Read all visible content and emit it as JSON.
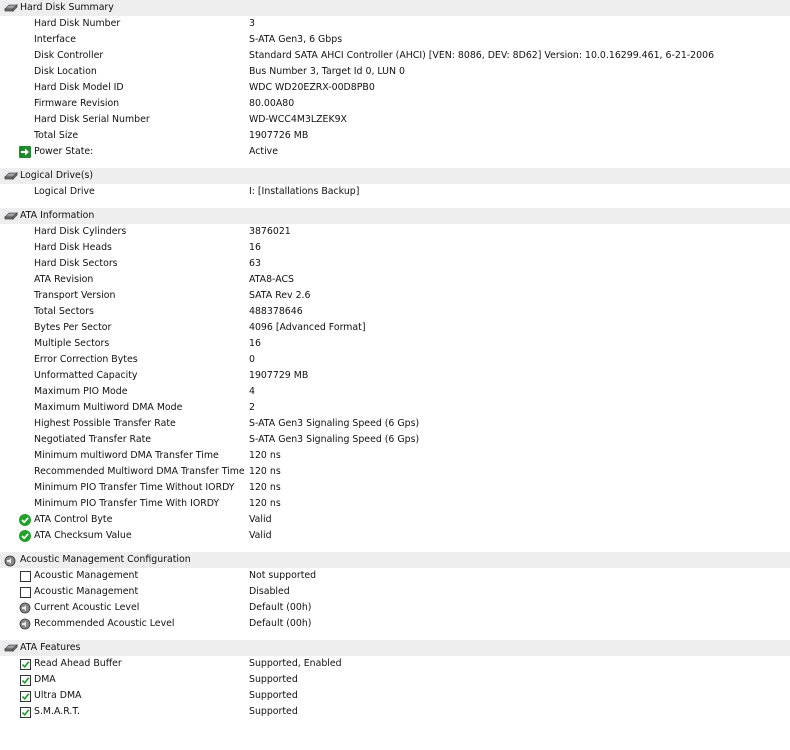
{
  "sections": [
    {
      "title": "Hard Disk Summary",
      "icon": "disk-icon",
      "rows": [
        {
          "label": "Hard Disk Number",
          "value": "3"
        },
        {
          "label": "Interface",
          "value": "S-ATA Gen3, 6 Gbps"
        },
        {
          "label": "Disk Controller",
          "value": "Standard SATA AHCI Controller (AHCI) [VEN: 8086, DEV: 8D62] Version: 10.0.16299.461, 6-21-2006"
        },
        {
          "label": "Disk Location",
          "value": "Bus Number 3, Target Id 0, LUN 0"
        },
        {
          "label": "Hard Disk Model ID",
          "value": "WDC WD20EZRX-00D8PB0"
        },
        {
          "label": "Firmware Revision",
          "value": "80.00A80"
        },
        {
          "label": "Hard Disk Serial Number",
          "value": "WD-WCC4M3LZEK9X"
        },
        {
          "label": "Total Size",
          "value": "1907726 MB"
        },
        {
          "label": "Power State:",
          "value": "Active",
          "icon": "power-arrow-icon"
        }
      ]
    },
    {
      "title": "Logical Drive(s)",
      "icon": "disk-icon",
      "rows": [
        {
          "label": "Logical Drive",
          "value": "I: [Installations Backup]"
        }
      ]
    },
    {
      "title": "ATA Information",
      "icon": "disk-icon",
      "rows": [
        {
          "label": "Hard Disk Cylinders",
          "value": "3876021"
        },
        {
          "label": "Hard Disk Heads",
          "value": "16"
        },
        {
          "label": "Hard Disk Sectors",
          "value": "63"
        },
        {
          "label": "ATA Revision",
          "value": "ATA8-ACS"
        },
        {
          "label": "Transport Version",
          "value": "SATA Rev 2.6"
        },
        {
          "label": "Total Sectors",
          "value": "488378646"
        },
        {
          "label": "Bytes Per Sector",
          "value": "4096 [Advanced Format]"
        },
        {
          "label": "Multiple Sectors",
          "value": "16"
        },
        {
          "label": "Error Correction Bytes",
          "value": "0"
        },
        {
          "label": "Unformatted Capacity",
          "value": "1907729 MB"
        },
        {
          "label": "Maximum PIO Mode",
          "value": "4"
        },
        {
          "label": "Maximum Multiword DMA Mode",
          "value": "2"
        },
        {
          "label": "Highest Possible Transfer Rate",
          "value": "S-ATA Gen3 Signaling Speed (6 Gps)"
        },
        {
          "label": "Negotiated Transfer Rate",
          "value": "S-ATA Gen3 Signaling Speed (6 Gps)"
        },
        {
          "label": "Minimum multiword DMA Transfer Time",
          "value": "120 ns"
        },
        {
          "label": "Recommended Multiword DMA Transfer Time",
          "value": "120 ns"
        },
        {
          "label": "Minimum PIO Transfer Time Without IORDY",
          "value": "120 ns"
        },
        {
          "label": "Minimum PIO Transfer Time With IORDY",
          "value": "120 ns"
        },
        {
          "label": "ATA Control Byte",
          "value": "Valid",
          "icon": "ok-check-icon"
        },
        {
          "label": "ATA Checksum Value",
          "value": "Valid",
          "icon": "ok-check-icon"
        }
      ]
    },
    {
      "title": "Acoustic Management Configuration",
      "icon": "speaker-icon",
      "rows": [
        {
          "label": "Acoustic Management",
          "value": "Not supported",
          "icon": "checkbox",
          "checked": false
        },
        {
          "label": "Acoustic Management",
          "value": "Disabled",
          "icon": "checkbox",
          "checked": false
        },
        {
          "label": "Current Acoustic Level",
          "value": "Default (00h)",
          "icon": "speaker-icon"
        },
        {
          "label": "Recommended Acoustic Level",
          "value": "Default (00h)",
          "icon": "speaker-icon"
        }
      ]
    },
    {
      "title": "ATA Features",
      "icon": "disk-icon",
      "rows": [
        {
          "label": "Read Ahead Buffer",
          "value": "Supported, Enabled",
          "icon": "checkbox",
          "checked": true
        },
        {
          "label": "DMA",
          "value": "Supported",
          "icon": "checkbox",
          "checked": true
        },
        {
          "label": "Ultra DMA",
          "value": "Supported",
          "icon": "checkbox",
          "checked": true
        },
        {
          "label": "S.M.A.R.T.",
          "value": "Supported",
          "icon": "checkbox",
          "checked": true
        }
      ]
    }
  ],
  "colors": {
    "header_bg": "#eeeeee",
    "ok_green": "#23a02c",
    "arrow_green": "#1f8a2c",
    "check_green": "#1a9a2a"
  }
}
